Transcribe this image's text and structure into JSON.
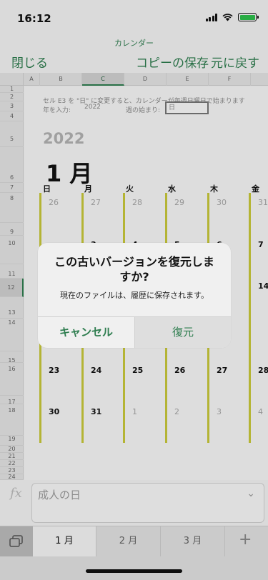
{
  "status_bar": {
    "time": "16:12"
  },
  "nav": {
    "title": "カレンダー",
    "close": "閉じる",
    "save_copy": "コピーの保存",
    "revert": "元に戻す"
  },
  "columns": [
    "A",
    "B",
    "C",
    "D",
    "E",
    "F"
  ],
  "rows": [
    "1",
    "2",
    "3",
    "4",
    "5",
    "6",
    "7",
    "8",
    "9",
    "10",
    "11",
    "12",
    "13",
    "14",
    "15",
    "16",
    "17",
    "18",
    "19",
    "20",
    "21",
    "22",
    "23",
    "24"
  ],
  "sheet": {
    "note": "セル E3 を \"日\" に変更すると、カレンダーが毎週日曜日で始まります",
    "year_label": "年を入力:",
    "year_value": "2022",
    "start_label": "週の始まり:",
    "start_value": "日",
    "year": "2022",
    "month": "1 月",
    "weekdays": [
      "日",
      "月",
      "火",
      "水",
      "木",
      "金"
    ],
    "week1": [
      "26",
      "27",
      "28",
      "29",
      "30",
      "31"
    ],
    "week2": [
      "2",
      "3",
      "4",
      "5",
      "6",
      "7"
    ],
    "week3": [
      "14"
    ],
    "week4": [
      "23",
      "24",
      "25",
      "26",
      "27",
      "28"
    ],
    "week5": [
      "30",
      "31",
      "1",
      "2",
      "3",
      "4"
    ]
  },
  "formula_bar": {
    "icon": "fx",
    "text": "成人の日"
  },
  "tabs": [
    "1 月",
    "2 月",
    "3 月"
  ],
  "dialog": {
    "title": "この古いバージョンを復元しますか?",
    "message": "現在のファイルは、履歴に保存されます。",
    "cancel": "キャンセル",
    "restore": "復元"
  },
  "colors": {
    "accent": "#2e7d4f",
    "bars": "#c9c93a"
  }
}
